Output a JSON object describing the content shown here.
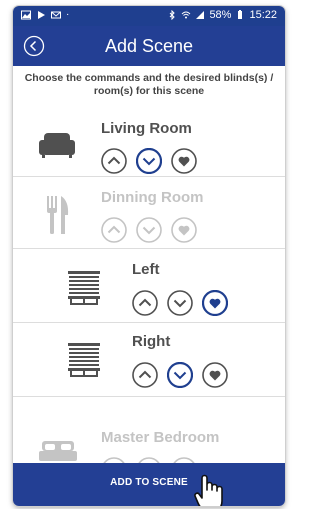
{
  "status_bar": {
    "battery": "58%",
    "time": "15:22"
  },
  "header": {
    "title": "Add Scene",
    "back_icon": "chevron-left-circle-icon"
  },
  "subtitle": "Choose the commands and the desired blinds(s) / room(s) for this scene",
  "rows": [
    {
      "name": "Living Room",
      "icon": "sofa-icon",
      "enabled": true,
      "selected": "down"
    },
    {
      "name": "Dinning Room",
      "icon": "fork-knife-icon",
      "enabled": false,
      "selected": null
    },
    {
      "name": "Left",
      "icon": "blind-icon",
      "enabled": true,
      "selected": "favorite"
    },
    {
      "name": "Right",
      "icon": "blind-icon",
      "enabled": true,
      "selected": "down"
    },
    {
      "name": "Master Bedroom",
      "icon": "bed-icon",
      "enabled": false,
      "selected": null
    }
  ],
  "bottom_button": {
    "label": "ADD TO SCENE"
  },
  "colors": {
    "primary": "#233f94",
    "selected_outline": "#1f3f8f",
    "enabled_icon": "#505050",
    "disabled_icon": "#c4c4c4"
  }
}
